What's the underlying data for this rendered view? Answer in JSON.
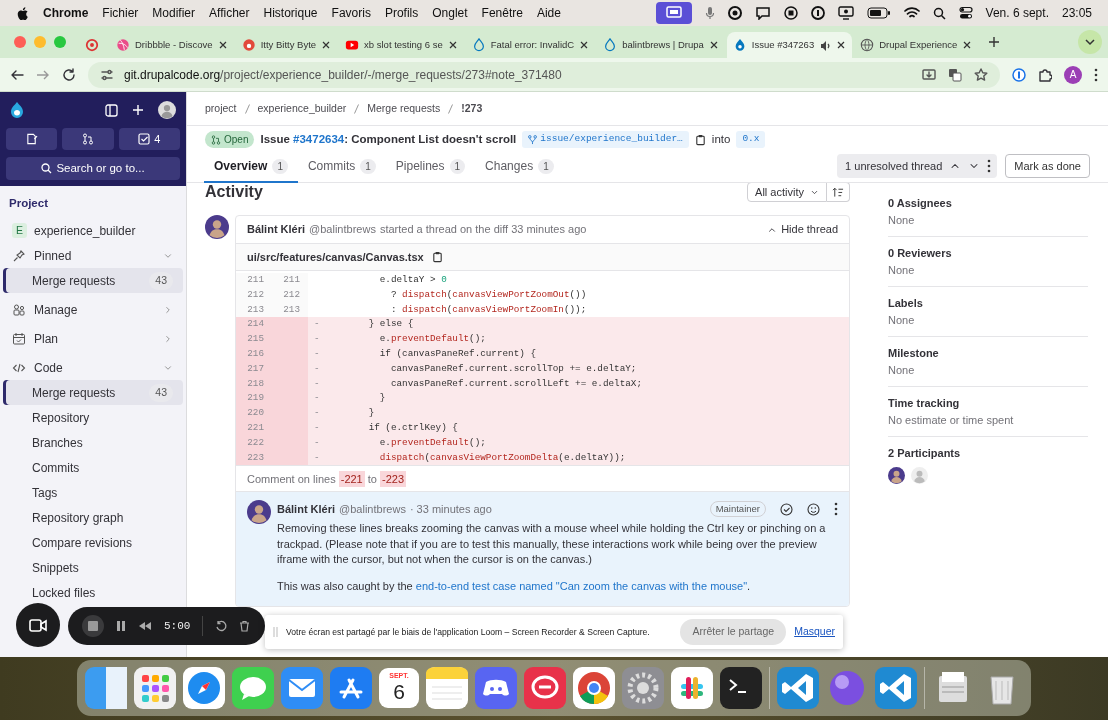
{
  "menu_bar": {
    "app": "Chrome",
    "menus": [
      "Fichier",
      "Modifier",
      "Afficher",
      "Historique",
      "Favoris",
      "Profils",
      "Onglet",
      "Fenêtre",
      "Aide"
    ],
    "date": "Ven. 6 sept.",
    "time": "23:05"
  },
  "browser_tabs": [
    {
      "kind": "pinned",
      "selected": false
    },
    {
      "kind": "page",
      "title": "Dribbble - Discove",
      "selected": false
    },
    {
      "kind": "page",
      "title": "Itty Bitty Byte",
      "selected": false
    },
    {
      "kind": "page",
      "title": "xb slot testing 6 se",
      "selected": false
    },
    {
      "kind": "page",
      "title": "Fatal error: InvalidC",
      "selected": false
    },
    {
      "kind": "page",
      "title": "balintbrews | Drupa",
      "selected": false
    },
    {
      "kind": "page",
      "title": "Issue #347263",
      "selected": true
    },
    {
      "kind": "page",
      "title": "Drupal Experience",
      "selected": false
    }
  ],
  "address_bar": {
    "host": "git.drupalcode.org",
    "path": "/project/experience_builder/-/merge_requests/273#note_371480",
    "profile_initial": "A"
  },
  "sidebar": {
    "todo_count": "4",
    "search_label": "Search or go to...",
    "heading": "Project",
    "project": {
      "initial": "E",
      "name": "experience_builder"
    },
    "groups": [
      {
        "label": "Pinned",
        "expanded": true,
        "children": [
          {
            "label": "Merge requests",
            "count": "43",
            "selected": true
          }
        ]
      },
      {
        "label": "Manage",
        "expanded": false
      },
      {
        "label": "Plan",
        "expanded": false
      },
      {
        "label": "Code",
        "expanded": true,
        "children": [
          {
            "label": "Merge requests",
            "count": "43",
            "selected": true
          },
          {
            "label": "Repository",
            "selected": false
          },
          {
            "label": "Branches",
            "selected": false
          },
          {
            "label": "Commits",
            "selected": false
          },
          {
            "label": "Tags",
            "selected": false
          },
          {
            "label": "Repository graph",
            "selected": false
          },
          {
            "label": "Compare revisions",
            "selected": false
          },
          {
            "label": "Snippets",
            "selected": false
          },
          {
            "label": "Locked files",
            "selected": false
          }
        ]
      }
    ]
  },
  "breadcrumbs": [
    "project",
    "experience_builder",
    "Merge requests",
    "!273"
  ],
  "merge_request": {
    "status": "Open",
    "title_prefix": "Issue ",
    "issue_link": "#3472634",
    "title_suffix": ": Component List doesn't scroll",
    "source_branch": "issue/experience_builder…",
    "into": "into",
    "target_branch": "0.x"
  },
  "tabs": [
    {
      "label": "Overview",
      "count": "1",
      "selected": true
    },
    {
      "label": "Commits",
      "count": "1",
      "selected": false
    },
    {
      "label": "Pipelines",
      "count": "1",
      "selected": false
    },
    {
      "label": "Changes",
      "count": "1",
      "selected": false
    }
  ],
  "thread_nav": {
    "label": "1 unresolved thread",
    "button": "Mark as done"
  },
  "activity": {
    "heading": "Activity",
    "filter": "All activity"
  },
  "thread": {
    "author": "Bálint Kléri",
    "handle": "@balintbrews",
    "action": "started a thread on the diff 33 minutes ago",
    "toggle": "Hide thread",
    "file": "ui/src/features/canvas/Canvas.tsx",
    "lines": [
      {
        "kind": "context",
        "old": "211",
        "new": "211",
        "code": "          e.deltaY > 0"
      },
      {
        "kind": "context",
        "old": "212",
        "new": "212",
        "code": "            ? dispatch(canvasViewPortZoomOut())"
      },
      {
        "kind": "context",
        "old": "213",
        "new": "213",
        "code": "            : dispatch(canvasViewPortZoomIn());"
      },
      {
        "kind": "removed",
        "old": "214",
        "sign": "-",
        "code": "        } else {"
      },
      {
        "kind": "removed",
        "old": "215",
        "sign": "-",
        "code": "          e.preventDefault();"
      },
      {
        "kind": "removed",
        "old": "216",
        "sign": "-",
        "code": "          if (canvasPaneRef.current) {"
      },
      {
        "kind": "removed",
        "old": "217",
        "sign": "-",
        "code": "            canvasPaneRef.current.scrollTop += e.deltaY;"
      },
      {
        "kind": "removed",
        "old": "218",
        "sign": "-",
        "code": "            canvasPaneRef.current.scrollLeft += e.deltaX;"
      },
      {
        "kind": "removed",
        "old": "219",
        "sign": "-",
        "code": "          }"
      },
      {
        "kind": "removed",
        "old": "220",
        "sign": "-",
        "code": "        }"
      },
      {
        "kind": "removed",
        "old": "221",
        "sign": "-",
        "code": "        if (e.ctrlKey) {"
      },
      {
        "kind": "removed",
        "old": "222",
        "sign": "-",
        "code": "          e.preventDefault();"
      },
      {
        "kind": "removed",
        "old": "223",
        "sign": "-",
        "code": "          dispatch(canvasViewPortZoomDelta(e.deltaY));"
      }
    ],
    "range": {
      "label": "Comment on lines",
      "start": "-221",
      "to": "to",
      "end": "-223"
    },
    "reply": {
      "author": "Bálint Kléri",
      "handle": "@balintbrews",
      "time": "· 33 minutes ago",
      "role": "Maintainer",
      "paragraph": "Removing these lines breaks zooming the canvas with a mouse wheel while holding the Ctrl key or pinching on a trackpad. (Please note that if you are to test this manually, these interactions work while being over the preview iframe with the cursor, but not when the cursor is on the canvas.)",
      "lead": "This was also caught by the ",
      "link": "end-to-end test case named \"Can zoom the canvas with the mouse\"",
      "tail": "."
    }
  },
  "details": [
    {
      "title": "0 Assignees",
      "value": "None"
    },
    {
      "title": "0 Reviewers",
      "value": "None"
    },
    {
      "title": "Labels",
      "value": "None"
    },
    {
      "title": "Milestone",
      "value": "None"
    },
    {
      "title": "Time tracking",
      "value": "No estimate or time spent"
    },
    {
      "title": "2 Participants"
    }
  ],
  "recorder": {
    "timer": "5:00"
  },
  "share_bar": {
    "message": "Votre écran est partagé par le biais de l'application Loom – Screen Recorder & Screen Capture.",
    "stop": "Arrêter le partage",
    "hide": "Masquer"
  },
  "dock": {
    "calendar_month": "SEPT.",
    "calendar_day": "6"
  }
}
